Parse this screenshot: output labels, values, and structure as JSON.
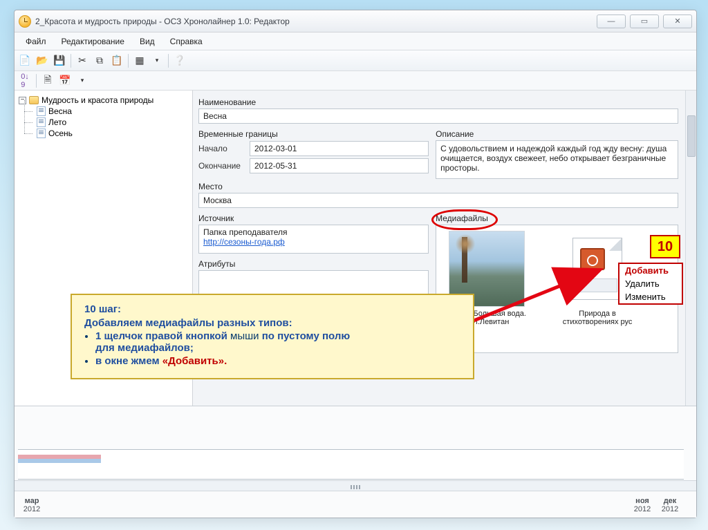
{
  "window": {
    "title": "2_Красота и мудрость природы - ОСЗ Хронолайнер 1.0: Редактор"
  },
  "menu": {
    "file": "Файл",
    "edit": "Редактирование",
    "view": "Вид",
    "help": "Справка"
  },
  "tree": {
    "root": "Мудрость и красота природы",
    "items": [
      "Весна",
      "Лето",
      "Осень"
    ]
  },
  "form": {
    "name_label": "Наименование",
    "name_value": "Весна",
    "time_bounds_label": "Временные границы",
    "start_label": "Начало",
    "start_value": "2012-03-01",
    "end_label": "Окончание",
    "end_value": "2012-05-31",
    "desc_label": "Описание",
    "desc_value": "С удовольствием и надеждой каждый год жду весну: душа очищается, воздух свежеет, небо открывает безграничные просторы.",
    "place_label": "Место",
    "place_value": "Москва",
    "source_label": "Источник",
    "source_text": "Папка преподавателя",
    "source_link": "http://сезоны-года.рф",
    "attributes_label": "Атрибуты",
    "media_label": "Медиафайлы",
    "media1_caption": "Весна. Большая вода. И.И.Левитан",
    "media2_caption": "Природа в стихотворениях рус"
  },
  "timeline": {
    "left1": "мар",
    "left1y": "2012",
    "r1": "ноя",
    "r1y": "2012",
    "r2": "дек",
    "r2y": "2012"
  },
  "context_menu": {
    "add": "Добавить",
    "del": "Удалить",
    "edit": "Изменить"
  },
  "badge": "10",
  "callout": {
    "title": "10 шаг:",
    "line1": "Добавляем медиафайлы разных типов:",
    "b1a": "1 щелчок правой кнопкой",
    "b1b": " мыши ",
    "b1c": "по пустому полю",
    "b1d": "для медиафайлов;",
    "b2a": "в окне жмем ",
    "b2b": "«Добавить»."
  }
}
